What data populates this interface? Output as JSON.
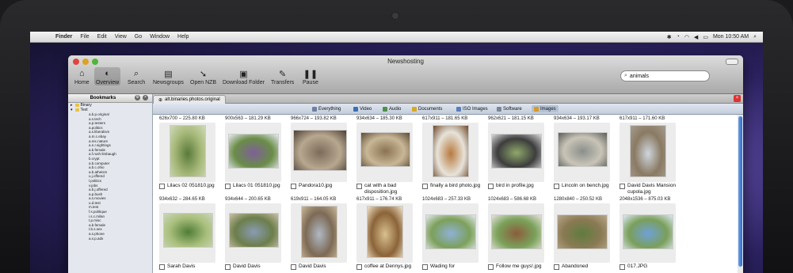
{
  "menubar": {
    "app": "Finder",
    "items": [
      "File",
      "Edit",
      "View",
      "Go",
      "Window",
      "Help"
    ],
    "clock": "Mon 10:50 AM"
  },
  "window": {
    "title": "Newshosting",
    "toolbar": [
      {
        "label": "Home",
        "icon": "home-icon"
      },
      {
        "label": "Overview",
        "icon": "overview-icon"
      },
      {
        "label": "Search",
        "icon": "search-icon"
      },
      {
        "label": "Newsgroups",
        "icon": "newsgroups-icon"
      },
      {
        "label": "Open NZB",
        "icon": "open-nzb-icon"
      },
      {
        "label": "Download Folder",
        "icon": "download-folder-icon"
      },
      {
        "label": "Transfers",
        "icon": "transfers-icon"
      },
      {
        "label": "Pause",
        "icon": "pause-icon"
      }
    ],
    "search_value": "animals"
  },
  "sidebar": {
    "title": "Bookmarks",
    "folders": [
      {
        "label": "Binary",
        "expanded": false
      },
      {
        "label": "Text",
        "expanded": true
      }
    ],
    "groups": [
      "a.b.p.original",
      "a.s.tech",
      "a.p.testers",
      "a.politics",
      "a.s.liberalism",
      "a.m.c.ebay",
      "a.rec.nature",
      "a.n.r.sightings",
      "a.b.female",
      "a.f.rush-limbaugh",
      "b.crypt",
      "a.b.computer",
      "a.b.c.ohio",
      "a.b.atheism",
      "u.j.offered",
      "l.politics",
      "v.jobs",
      "a.b.j.offered",
      "a.p.bush",
      "a.s.movies",
      "u.d.test",
      "m.test",
      "f.s.politique",
      "i.s.c.milan",
      "t.p.misc",
      "a.b.female",
      "t.b.s.sex",
      "a.s.phone",
      "a.s.p.ads"
    ]
  },
  "tab": {
    "label": "alt.binaries.photos.original"
  },
  "filters": [
    {
      "label": "Everything",
      "color": "#6f7fa0"
    },
    {
      "label": "Video",
      "color": "#3a6fb5"
    },
    {
      "label": "Audio",
      "color": "#4f8f4a"
    },
    {
      "label": "Documents",
      "color": "#d9a82b"
    },
    {
      "label": "ISO Images",
      "color": "#5a7fb8"
    },
    {
      "label": "Software",
      "color": "#7b8798"
    },
    {
      "label": "Images",
      "color": "#d89a2a",
      "active": true
    }
  ],
  "results": [
    {
      "meta": "626x700 – 225.80 KB",
      "name": "Lilacs 02 051810.jpg",
      "palette": [
        "#5a7a3a",
        "#a7b97a",
        "#cfd9b8"
      ]
    },
    {
      "meta": "900x563 – 181.29 KB",
      "name": "Lilacs 01 051810.jpg",
      "palette": [
        "#7d5f9a",
        "#6a8d47",
        "#e7eaf2"
      ]
    },
    {
      "meta": "966x724 – 193.82 KB",
      "name": "Pandora10.jpg",
      "palette": [
        "#7c6b5a",
        "#b8a890",
        "#4c4035"
      ]
    },
    {
      "meta": "934x634 – 185.30 KB",
      "name": "cat with a bad disposition.jpg",
      "palette": [
        "#8a7252",
        "#c8b796",
        "#5d4b34"
      ]
    },
    {
      "meta": "617x911 – 181.65 KB",
      "name": "finally a bird photo.jpg",
      "palette": [
        "#b77a3e",
        "#e7e3da",
        "#6e4a2a"
      ]
    },
    {
      "meta": "962x621 – 181.15 KB",
      "name": "bird in profile.jpg",
      "palette": [
        "#8fa86b",
        "#3d3d3d",
        "#d8d8d8"
      ]
    },
    {
      "meta": "934x634 – 193.17 KB",
      "name": "Lincoln on bench.jpg",
      "palette": [
        "#8a8f8c",
        "#c9c4b7",
        "#5a5d57"
      ]
    },
    {
      "meta": "617x911 – 171.60 KB",
      "name": "David Davis Mansion cupola.jpg",
      "palette": [
        "#cfd6de",
        "#8a7a63",
        "#a59c90"
      ]
    },
    {
      "meta": "934x632 – 284.65 KB",
      "name": "Sarah Davis",
      "palette": [
        "#4f7d36",
        "#a9bf7c",
        "#cbd6ba"
      ]
    },
    {
      "meta": "934x644 – 200.65 KB",
      "name": "David Davis",
      "palette": [
        "#8a9bb4",
        "#6b7e4a",
        "#cbc0a7"
      ]
    },
    {
      "meta": "619x911 – 164.05 KB",
      "name": "David Davis",
      "palette": [
        "#b0b9c4",
        "#7d6a55",
        "#c9b79a"
      ]
    },
    {
      "meta": "617x911 – 176.74 KB",
      "name": "coffee at Dennys.jpg",
      "palette": [
        "#d9c08f",
        "#8b6339",
        "#f0e2c6"
      ]
    },
    {
      "meta": "1024x683 – 257.33 KB",
      "name": "Wading for",
      "palette": [
        "#8fb1d8",
        "#7ca05a",
        "#e3e8ef"
      ]
    },
    {
      "meta": "1024x683 – 586.68 KB",
      "name": "Follow me guys!.jpg",
      "palette": [
        "#8b5c3c",
        "#7aa25a",
        "#e7e2dc"
      ]
    },
    {
      "meta": "1280x840 – 250.52 KB",
      "name": "Abandoned",
      "palette": [
        "#5f7c3e",
        "#8a7a54",
        "#b7a78a"
      ]
    },
    {
      "meta": "2048x1536 – 875.03 KB",
      "name": "017.JPG",
      "palette": [
        "#6fa0d8",
        "#7a9f5a",
        "#dfe8f3"
      ]
    }
  ]
}
